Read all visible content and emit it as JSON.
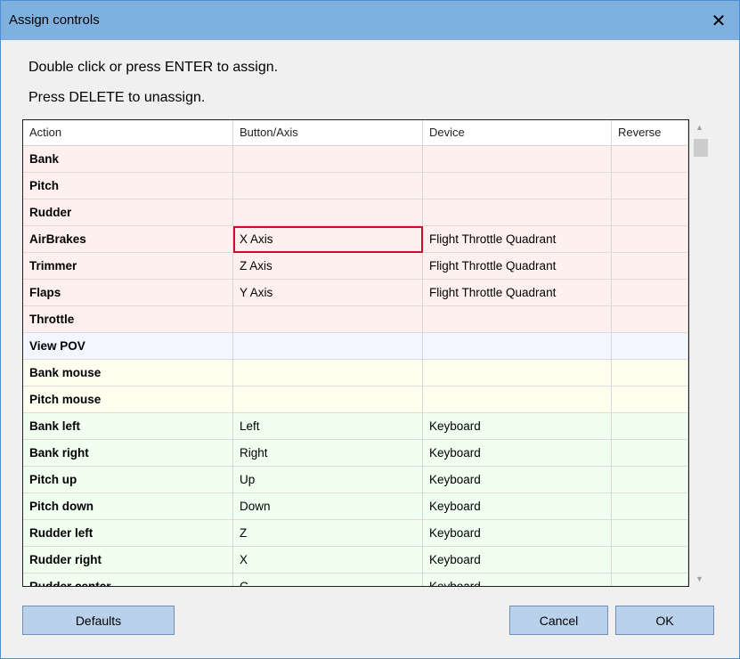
{
  "window": {
    "title": "Assign controls",
    "close_glyph": "✕"
  },
  "instructions": {
    "line1": "Double click or press ENTER to assign.",
    "line2": "Press DELETE to unassign."
  },
  "table": {
    "columns": [
      "Action",
      "Button/Axis",
      "Device",
      "Reverse"
    ],
    "selected_cell": {
      "row": 3,
      "column": 1
    },
    "rows": [
      {
        "action": "Bank",
        "button": "",
        "device": "",
        "reverse": "",
        "group": "axis"
      },
      {
        "action": "Pitch",
        "button": "",
        "device": "",
        "reverse": "",
        "group": "axis"
      },
      {
        "action": "Rudder",
        "button": "",
        "device": "",
        "reverse": "",
        "group": "axis"
      },
      {
        "action": "AirBrakes",
        "button": "X Axis",
        "device": "Flight Throttle Quadrant",
        "reverse": "",
        "group": "axis"
      },
      {
        "action": "Trimmer",
        "button": "Z Axis",
        "device": "Flight Throttle Quadrant",
        "reverse": "",
        "group": "axis"
      },
      {
        "action": "Flaps",
        "button": "Y Axis",
        "device": "Flight Throttle Quadrant",
        "reverse": "",
        "group": "axis"
      },
      {
        "action": "Throttle",
        "button": "",
        "device": "",
        "reverse": "",
        "group": "axis"
      },
      {
        "action": "View POV",
        "button": "",
        "device": "",
        "reverse": "",
        "group": "pov"
      },
      {
        "action": "Bank mouse",
        "button": "",
        "device": "",
        "reverse": "",
        "group": "mouse"
      },
      {
        "action": "Pitch mouse",
        "button": "",
        "device": "",
        "reverse": "",
        "group": "mouse"
      },
      {
        "action": "Bank left",
        "button": "Left",
        "device": "Keyboard",
        "reverse": "",
        "group": "key"
      },
      {
        "action": "Bank right",
        "button": "Right",
        "device": "Keyboard",
        "reverse": "",
        "group": "key"
      },
      {
        "action": "Pitch up",
        "button": "Up",
        "device": "Keyboard",
        "reverse": "",
        "group": "key"
      },
      {
        "action": "Pitch down",
        "button": "Down",
        "device": "Keyboard",
        "reverse": "",
        "group": "key"
      },
      {
        "action": "Rudder left",
        "button": "Z",
        "device": "Keyboard",
        "reverse": "",
        "group": "key"
      },
      {
        "action": "Rudder right",
        "button": "X",
        "device": "Keyboard",
        "reverse": "",
        "group": "key"
      },
      {
        "action": "Rudder center",
        "button": "C",
        "device": "Keyboard",
        "reverse": "",
        "group": "key"
      }
    ]
  },
  "group_colors": {
    "axis": "#fff0f0",
    "pov": "#f4f6ff",
    "mouse": "#fffff0",
    "key": "#f0fff0"
  },
  "scrollbar": {
    "up_glyph": "▲",
    "down_glyph": "▼"
  },
  "buttons": {
    "defaults": "Defaults",
    "cancel": "Cancel",
    "ok": "OK"
  }
}
